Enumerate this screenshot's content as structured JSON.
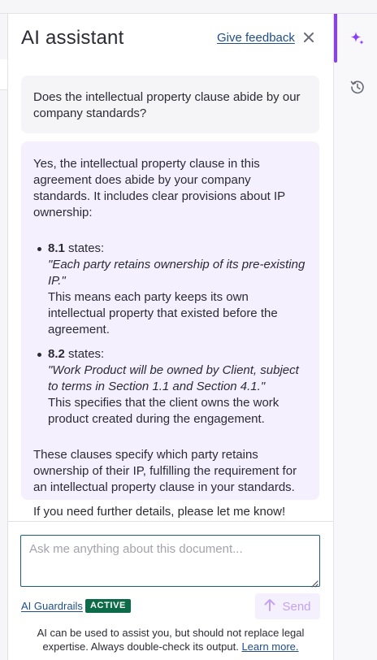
{
  "panel": {
    "title": "AI assistant",
    "feedback_label": "Give feedback"
  },
  "conversation": {
    "user_message": "Does the intellectual property clause abide by our company standards?",
    "assistant": {
      "intro": "Yes, the intellectual property clause in this agreement does abide by your company standards. It includes clear provisions about IP ownership:",
      "items": [
        {
          "ref": "8.1",
          "verb": " states:",
          "quote": "\"Each party retains ownership of its pre-existing IP.\"",
          "explanation": "This means each party keeps its own intellectual property that existed before the agreement."
        },
        {
          "ref": "8.2",
          "verb": " states:",
          "quote": "\"Work Product will be owned by Client, subject to terms in Section 1.1 and Section 4.1.\"",
          "explanation": "This specifies that the client owns the work product created during the engagement."
        }
      ],
      "summary": "These clauses specify which party retains ownership of their IP, fulfilling the requirement for an intellectual property clause in your standards.",
      "closing": "If you need further details, please let me know!"
    }
  },
  "composer": {
    "placeholder": "Ask me anything about this document...",
    "guardrails_label": "AI Guardrails",
    "guardrails_status": "ACTIVE",
    "send_label": "Send"
  },
  "footer": {
    "disclaimer": "AI can be used to assist you, but should not replace legal expertise. Always double-check its output.",
    "learn_more": "Learn more."
  },
  "rail": {
    "icons": [
      "sparkle-icon",
      "history-icon"
    ]
  },
  "colors": {
    "accent": "#8b3dff",
    "link": "#1f4d8a",
    "badge": "#0e6b4a",
    "assistant_bubble": "#f5f0fd",
    "user_bubble": "#f5f5f7"
  }
}
